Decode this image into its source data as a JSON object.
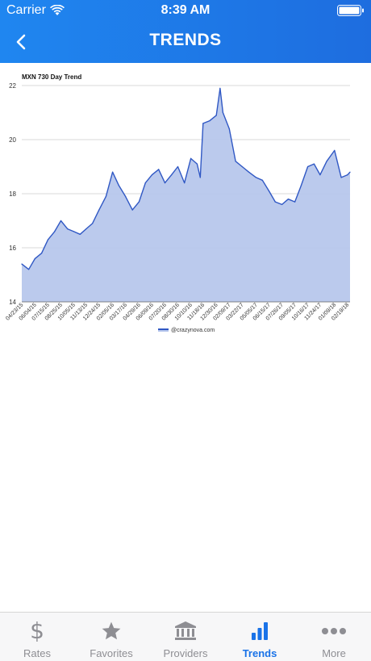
{
  "status_bar": {
    "carrier": "Carrier",
    "time": "8:39 AM"
  },
  "nav": {
    "title": "TRENDS"
  },
  "colors": {
    "header": "#1e78ea",
    "active_tab": "#1a73e8",
    "inactive_tab": "#8e8e93",
    "line": "#3058c4",
    "fill": "#b7c7ec"
  },
  "chart_data": {
    "type": "area",
    "title": "MXN 730 Day Trend",
    "legend": "@crazynova.com",
    "legend_position": "bottom",
    "ylim": [
      14,
      22
    ],
    "yticks": [
      14,
      16,
      18,
      20,
      22
    ],
    "grid": true,
    "xlim": [
      "04/23/15",
      "02/27/18"
    ],
    "xticks": [
      "04/23/15",
      "06/04/15",
      "07/15/15",
      "08/25/15",
      "10/05/15",
      "11/13/15",
      "12/24/15",
      "02/05/16",
      "03/17/16",
      "04/29/16",
      "06/09/16",
      "07/20/16",
      "08/30/16",
      "10/10/16",
      "11/18/16",
      "12/30/16",
      "02/09/17",
      "03/22/17",
      "05/05/17",
      "06/15/17",
      "07/26/17",
      "09/05/17",
      "10/16/17",
      "11/24/17",
      "01/09/18",
      "02/19/18"
    ],
    "x": [
      "04/23/15",
      "05/15/15",
      "06/04/15",
      "06/25/15",
      "07/15/15",
      "08/05/15",
      "08/25/15",
      "09/15/15",
      "10/05/15",
      "10/25/15",
      "11/13/15",
      "12/03/15",
      "12/24/15",
      "01/15/16",
      "02/05/16",
      "02/25/16",
      "03/17/16",
      "04/08/16",
      "04/29/16",
      "05/19/16",
      "06/09/16",
      "06/30/16",
      "07/20/16",
      "08/10/16",
      "08/30/16",
      "09/20/16",
      "10/10/16",
      "10/30/16",
      "11/09/16",
      "11/18/16",
      "12/09/16",
      "12/30/16",
      "01/11/17",
      "01/20/17",
      "02/09/17",
      "03/01/17",
      "03/22/17",
      "04/12/17",
      "05/05/17",
      "05/25/17",
      "06/15/17",
      "07/05/17",
      "07/26/17",
      "08/15/17",
      "09/05/17",
      "09/25/17",
      "10/16/17",
      "11/05/17",
      "11/24/17",
      "12/15/17",
      "01/09/18",
      "01/30/18",
      "02/19/18",
      "02/27/18"
    ],
    "values": [
      15.4,
      15.2,
      15.6,
      15.8,
      16.3,
      16.6,
      17.0,
      16.7,
      16.6,
      16.5,
      16.7,
      16.9,
      17.4,
      17.9,
      18.8,
      18.3,
      17.9,
      17.4,
      17.7,
      18.4,
      18.7,
      18.9,
      18.4,
      18.7,
      19.0,
      18.4,
      19.3,
      19.1,
      18.6,
      20.6,
      20.7,
      20.9,
      21.9,
      21.0,
      20.4,
      19.2,
      19.0,
      18.8,
      18.6,
      18.5,
      18.1,
      17.7,
      17.6,
      17.8,
      17.7,
      18.3,
      19.0,
      19.1,
      18.7,
      19.2,
      19.6,
      18.6,
      18.7,
      18.8
    ]
  },
  "tabs": [
    {
      "id": "rates",
      "label": "Rates",
      "icon": "dollar-icon"
    },
    {
      "id": "favorites",
      "label": "Favorites",
      "icon": "star-icon"
    },
    {
      "id": "providers",
      "label": "Providers",
      "icon": "bank-icon"
    },
    {
      "id": "trends",
      "label": "Trends",
      "icon": "bar-chart-icon",
      "active": true
    },
    {
      "id": "more",
      "label": "More",
      "icon": "more-dots-icon"
    }
  ]
}
